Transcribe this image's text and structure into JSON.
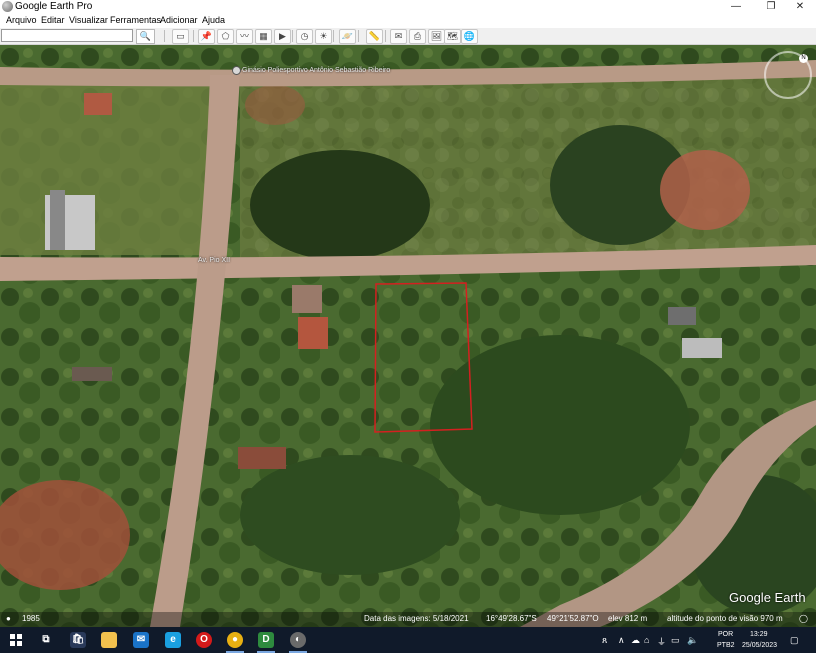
{
  "window": {
    "title": "Google Earth Pro",
    "minimize_label": "—",
    "maximize_label": "❐",
    "close_label": "✕"
  },
  "menu": {
    "items": [
      "Arquivo",
      "Editar",
      "Visualizar",
      "Ferramentas",
      "Adicionar",
      "Ajuda"
    ]
  },
  "toolbar": {
    "search_value": "",
    "icons": [
      "sidebar-toggle-icon",
      "placemark-icon",
      "polygon-icon",
      "path-icon",
      "image-overlay-icon",
      "tour-record-icon",
      "historical-imagery-icon",
      "sunlight-icon",
      "planets-icon",
      "ruler-icon",
      "email-icon",
      "print-icon",
      "save-image-icon",
      "maps-view-icon"
    ]
  },
  "map": {
    "place_label": "Ginásio Poliesportivo Antônio Sebastião Ribeiro",
    "street_label": "Av. Pio XII",
    "watermark": "Google Earth",
    "compass_north": "N",
    "highlight_color": "#d42020"
  },
  "statusbar": {
    "tour_year": "1985",
    "image_date": "Data das imagens: 5/18/2021",
    "latitude": "16°49'28.67\"S",
    "longitude": "49°21'52.87\"O",
    "elevation": "elev  812 m",
    "eye_altitude": "altitude do ponto de visão   970 m"
  },
  "taskbar": {
    "apps": [
      {
        "name": "task-view-icon",
        "glyph": "⧉",
        "color": "#101a2a"
      },
      {
        "name": "store-icon",
        "glyph": "🛍",
        "color": "#101a2a"
      },
      {
        "name": "file-explorer-icon",
        "glyph": "",
        "color": "#f2c14e"
      },
      {
        "name": "mail-icon",
        "glyph": "✉",
        "color": "#1a73c8"
      },
      {
        "name": "edge-icon",
        "glyph": "e",
        "color": "#1aa0e0"
      },
      {
        "name": "opera-icon",
        "glyph": "O",
        "color": "#d41a1a"
      },
      {
        "name": "chrome-icon",
        "glyph": "●",
        "color": "#e8b012"
      },
      {
        "name": "dashboard-app-icon",
        "glyph": "D",
        "color": "#2e8b3e"
      },
      {
        "name": "google-earth-icon",
        "glyph": "◐",
        "color": "#6a6a6a"
      }
    ],
    "language": "POR",
    "keyboard": "PTB2",
    "time": "13:29",
    "date": "25/05/2023"
  }
}
